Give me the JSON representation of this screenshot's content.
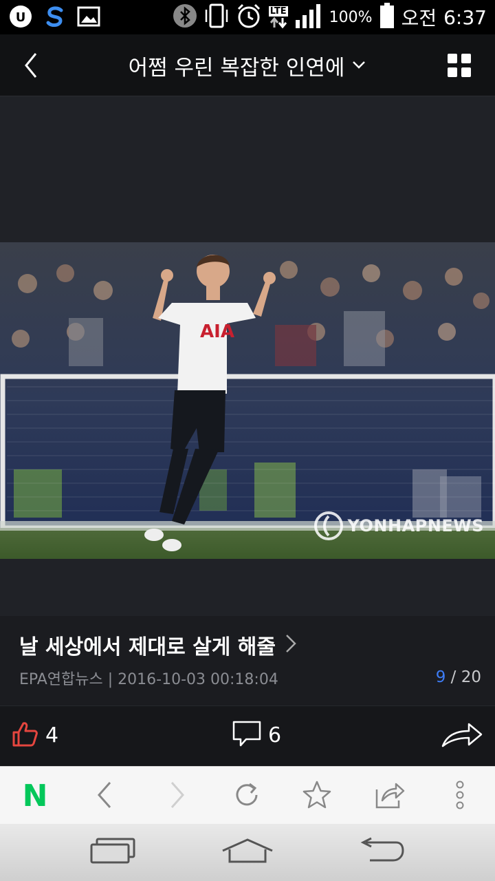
{
  "status_bar": {
    "battery": "100%",
    "network": "LTE",
    "ampm": "오전",
    "time": "6:37",
    "icons": [
      "u-plus-icon",
      "s-app-icon",
      "gallery-icon",
      "bluetooth-icon",
      "vibrate-icon",
      "alarm-icon",
      "lte-icon",
      "signal-icon",
      "battery-icon"
    ]
  },
  "header": {
    "title": "어쩜 우린 복잡한 인연에",
    "icons": [
      "back-chevron-icon",
      "dropdown-chevron-icon",
      "grid-view-icon"
    ]
  },
  "photo": {
    "watermark": "YONHAPNEWS",
    "jersey_text": "AIA"
  },
  "caption": {
    "title": "날 세상에서 제대로 살게 해줄",
    "meta": "EPA연합뉴스 | 2016-10-03 00:18:04",
    "page_current": "9",
    "page_separator": " / ",
    "page_total": "20"
  },
  "actions": {
    "like_count": "4",
    "comment_count": "6",
    "icons": [
      "thumbs-up-icon",
      "comment-icon",
      "share-arrow-icon"
    ]
  },
  "browser_toolbar": {
    "icons": [
      "naver-home-icon",
      "browser-back-icon",
      "browser-forward-icon",
      "refresh-icon",
      "bookmark-star-icon",
      "share-icon",
      "more-vert-icon"
    ],
    "naver_letter": "N"
  },
  "nav_bar": {
    "icons": [
      "recent-apps-icon",
      "home-icon",
      "system-back-icon"
    ]
  },
  "colors": {
    "accent_blue": "#3d7cf5",
    "like_red": "#e5463f",
    "naver_green": "#03c75a",
    "background": "#202227"
  }
}
